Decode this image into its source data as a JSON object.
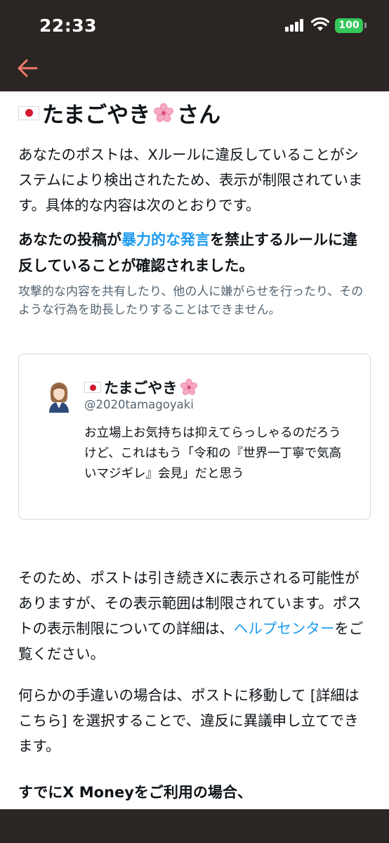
{
  "status_bar": {
    "time": "22:33",
    "battery": "100"
  },
  "header": {
    "back_icon": "arrow-left-icon",
    "accent_color": "#f07a6b"
  },
  "notice": {
    "greeting_name": "たまごやき",
    "greeting_suffix": "さん",
    "intro": "あなたのポストは、Xルールに違反していることがシステムにより検出されたため、表示が制限されています。具体的な内容は次のとおりです。",
    "violation_prefix": "あなたの投稿が",
    "violation_link": "暴力的な発言",
    "violation_suffix": "を禁止するルールに違反していることが確認されました。",
    "violation_detail": "攻撃的な内容を共有したり、他の人に嫌がらせを行ったり、そのような行為を助長したりすることはできません。"
  },
  "post": {
    "display_name": "たまごやき",
    "handle": "@2020tamagoyaki",
    "text": "お立場上お気持ちは抑えてらっしゃるのだろうけど、これはもう「令和の『世界一丁寧で気高いマジギレ』会見」だと思う"
  },
  "body": {
    "visibility_text": "そのため、ポストは引き続きXに表示される可能性がありますが、その表示範囲は制限されています。ポストの表示制限についての詳細は、",
    "help_link": "ヘルプセンター",
    "visibility_suffix": "をご覧ください。",
    "appeal_text": "何らかの手違いの場合は、ポストに移動して [詳細はこちら] を選択することで、違反に異議申し立てできます。",
    "money_heading": "すでにX Moneyをご利用の場合、"
  },
  "colors": {
    "link": "#1d9bf0",
    "bar": "#2b2523",
    "battery": "#34c759"
  }
}
